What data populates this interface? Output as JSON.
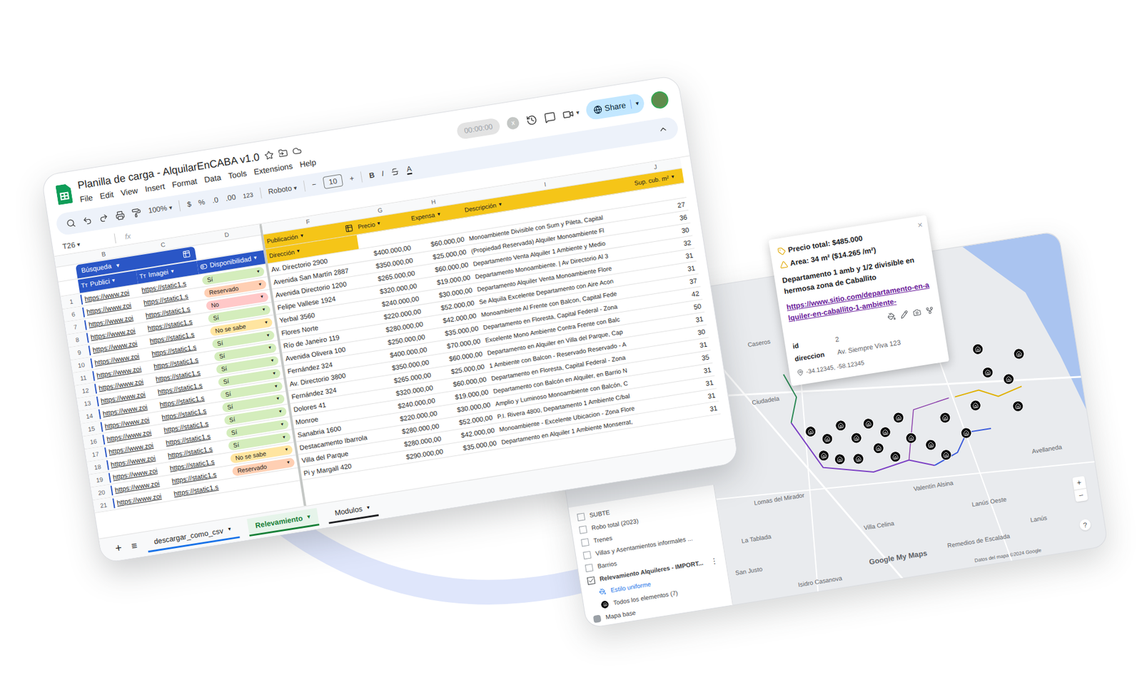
{
  "sheet": {
    "title": "Planilla de carga - AlquilarEnCABA v1.0",
    "menus": [
      "File",
      "Edit",
      "View",
      "Insert",
      "Format",
      "Data",
      "Tools",
      "Extensions",
      "Help"
    ],
    "timer": "00:00:00",
    "timer_close": "x",
    "share": "Share",
    "caret": "▾",
    "toolbar": {
      "zoom": "100%",
      "currency": "$",
      "percent": "%",
      "dec_less": ".0",
      "dec_more": ".00",
      "number_format": "123",
      "font": "Roboto",
      "size_minus": "−",
      "font_size": "10",
      "size_plus": "+",
      "bold": "B",
      "italic": "I",
      "text_color": "A"
    },
    "cell_ref": "T26",
    "fx": "fx",
    "left_columns": [
      "B",
      "C",
      "D"
    ],
    "right_columns": [
      "F",
      "G",
      "H",
      "I",
      "J"
    ],
    "left_group": "Búsqueda",
    "left_headers": [
      {
        "icon": "Tт",
        "label": "Publici"
      },
      {
        "icon": "Tт",
        "label": "Imagei"
      },
      {
        "icon": "",
        "label": "Disponibilidad"
      }
    ],
    "right_headers": [
      "Publicación",
      "Precio",
      "Expensa",
      "Descripción",
      "Sup. cub. m²"
    ],
    "right_subheader": "Dirección",
    "rows": [
      {
        "n": "1",
        "link": "https://www.zoi",
        "image": "https://static1.s",
        "availability": "Sí",
        "availability_color": "#d4edbc",
        "address": "Av. Directorio 2900",
        "price": "$400.000,00",
        "expense": "$60.000,00",
        "description": "Monoambiente Divisible con Sum y Pileta, Capital",
        "area": "27"
      },
      {
        "n": "6",
        "link": "https://www.zoi",
        "image": "https://static1.s",
        "availability": "Reservado",
        "availability_color": "#ffcfb3",
        "address": "Avenida San Martín 2887",
        "price": "$350.000,00",
        "expense": "$25.000,00",
        "description": "(Propiedad Reservada) Alquiler Monoambiente Fl",
        "area": "36"
      },
      {
        "n": "7",
        "link": "https://www.zoi",
        "image": "https://static1.s",
        "availability": "No",
        "availability_color": "#ffc8c8",
        "address": "Avenida Directorio 1200",
        "price": "$265.000,00",
        "expense": "$60.000,00",
        "description": "Departamento Venta Alquiler 1 Ambiente y Medio",
        "area": "30"
      },
      {
        "n": "8",
        "link": "https://www.zoi",
        "image": "https://static1.s",
        "availability": "Sí",
        "availability_color": "#d4edbc",
        "address": "Felipe Vallese 1924",
        "price": "$320.000,00",
        "expense": "$19.000,00",
        "description": "Departamento Monoambiente. | Av Directorio Al 3",
        "area": "32"
      },
      {
        "n": "9",
        "link": "https://www.zoi",
        "image": "https://static1.s",
        "availability": "No se sabe",
        "availability_color": "#ffe5a0",
        "address": "Yerbal 3560",
        "price": "$240.000,00",
        "expense": "$30.000,00",
        "description": "Departamento Alquiler Venta Monoambiente Flore",
        "area": "31"
      },
      {
        "n": "10",
        "link": "https://www.zoi",
        "image": "https://static1.s",
        "availability": "Sí",
        "availability_color": "#d4edbc",
        "address": "Flores Norte",
        "price": "$220.000,00",
        "expense": "$52.000,00",
        "description": "Se Alquila Excelente Departamento con Aire Acon",
        "area": "31"
      },
      {
        "n": "11",
        "link": "https://www.zoi",
        "image": "https://static1.s",
        "availability": "Sí",
        "availability_color": "#d4edbc",
        "address": "Río de Janeiro 119",
        "price": "$280.000,00",
        "expense": "$42.000,00",
        "description": "Monoambiente Al Frente con Balcon, Capital Fede",
        "area": "37"
      },
      {
        "n": "12",
        "link": "https://www.zoi",
        "image": "https://static1.s",
        "availability": "Sí",
        "availability_color": "#d4edbc",
        "address": "Avenida Olivera 100",
        "price": "$250.000,00",
        "expense": "$35.000,00",
        "description": "Departamento en Floresta, Capital Federal - Zona",
        "area": "42"
      },
      {
        "n": "13",
        "link": "https://www.zoi",
        "image": "https://static1.s",
        "availability": "Sí",
        "availability_color": "#d4edbc",
        "address": "Fernández 324",
        "price": "$400.000,00",
        "expense": "$70.000,00",
        "description": "Excelente Mono Ambiente Contra Frente con Balc",
        "area": "50"
      },
      {
        "n": "14",
        "link": "https://www.zoi",
        "image": "https://static1.s",
        "availability": "Sí",
        "availability_color": "#d4edbc",
        "address": "Av. Directorio 3800",
        "price": "$350.000,00",
        "expense": "$60.000,00",
        "description": "Departamento en Alquiler en Villa del Parque, Cap",
        "area": "31"
      },
      {
        "n": "15",
        "link": "https://www.zoi",
        "image": "https://static1.s",
        "availability": "Sí",
        "availability_color": "#d4edbc",
        "address": "Fernández 324",
        "price": "$265.000,00",
        "expense": "$25.000,00",
        "description": "1 Ambiente con Balcon - Reservado Reservado - A",
        "area": "30"
      },
      {
        "n": "16",
        "link": "https://www.zoi",
        "image": "https://static1.s",
        "availability": "Sí",
        "availability_color": "#d4edbc",
        "address": "Dolores 41",
        "price": "$320.000,00",
        "expense": "$60.000,00",
        "description": "Departamento en Floresta, Capital Federal - Zona",
        "area": "31"
      },
      {
        "n": "17",
        "link": "https://www.zoi",
        "image": "https://static1.s",
        "availability": "Sí",
        "availability_color": "#d4edbc",
        "address": "Monroe",
        "price": "$240.000,00",
        "expense": "$19.000,00",
        "description": "Departamento con Balcón en Alquiler, en Barrio N",
        "area": "35"
      },
      {
        "n": "18",
        "link": "https://www.zoi",
        "image": "https://static1.s",
        "availability": "Sí",
        "availability_color": "#d4edbc",
        "address": "Sanabria 1600",
        "price": "$220.000,00",
        "expense": "$30.000,00",
        "description": "Amplio y Luminoso Monoambiente con Balcón, C",
        "area": "31"
      },
      {
        "n": "19",
        "link": "https://www.zoi",
        "image": "https://static1.s",
        "availability": "No se sabe",
        "availability_color": "#ffe5a0",
        "address": "Destacamento Ibarrola",
        "price": "$280.000,00",
        "expense": "$52.000,00",
        "description": "P.I. Rivera 4800, Departamento 1 Ambiente C/bal",
        "area": "31"
      },
      {
        "n": "20",
        "link": "https://www.zoi",
        "image": "https://static1.s",
        "availability": "Reservado",
        "availability_color": "#ffcfb3",
        "address": "Villa del Parque",
        "price": "$280.000,00",
        "expense": "$42.000,00",
        "description": "Monoambiente - Excelente Ubicacion - Zona Flore",
        "area": "31"
      },
      {
        "n": "21",
        "link": "https://www.zoi",
        "image": "https://static1.s",
        "availability": "",
        "availability_color": "#ffffff",
        "address": "Pi y Margall 420",
        "price": "$290.000,00",
        "expense": "$35.000,00",
        "description": "Departamento en Alquiler 1 Ambiente Monserrat,",
        "area": "31"
      }
    ],
    "tabs": [
      {
        "label": "descargar_como_csv",
        "selected": false,
        "color": "#1a73e8"
      },
      {
        "label": "Relevamiento",
        "selected": true,
        "color": "#188038"
      },
      {
        "label": "Modulos",
        "selected": false,
        "color": "#202124"
      }
    ],
    "add_sheet": "+",
    "all_sheets": "≡"
  },
  "map": {
    "popup": {
      "close": "×",
      "price": "Precio total: $485.000",
      "area": "Area: 34 m² ($14.265 /m²)",
      "title": "Departamento 1 amb y 1/2 divisible en hermosa zona de Caballito",
      "link": "https://www.sitio.com/departamento-en-alquiler-en-caballito-1-ambiente-",
      "fields": [
        {
          "key": "id",
          "value": "2"
        },
        {
          "key": "direccion",
          "value": "Av. Siempre Viva 123"
        }
      ],
      "coords": "-34.12345, -58.12345"
    },
    "layers": [
      {
        "label": "SUBTE",
        "kind": "checkbox",
        "checked": false
      },
      {
        "label": "Robo total (2023)",
        "kind": "checkbox",
        "checked": false
      },
      {
        "label": "Trenes",
        "kind": "checkbox",
        "checked": false
      },
      {
        "label": "Villas y Asentamientos informales ...",
        "kind": "checkbox",
        "checked": false
      },
      {
        "label": "Barrios",
        "kind": "checkbox",
        "checked": false
      },
      {
        "label": "Relevamiento Alquileres - IMPORT...",
        "kind": "checkbox",
        "checked": true,
        "menu": "⋮"
      },
      {
        "label": "Estilo uniforme",
        "kind": "style",
        "checked": false
      },
      {
        "label": "Todos los elementos (7)",
        "kind": "group",
        "checked": false
      },
      {
        "label": "Mapa base",
        "kind": "base",
        "checked": false
      }
    ],
    "labels": [
      "Caseros",
      "Ciudadela",
      "Lomas del Mirador",
      "La Tablada",
      "San Justo",
      "Isidro Casanova",
      "Villa Celina",
      "Valentín Alsina",
      "Lanús Oeste",
      "Lanús",
      "Avellaneda",
      "Remedios de Escalada"
    ],
    "zoom_in": "+",
    "zoom_out": "−",
    "help": "?",
    "brand": "Google My Maps",
    "attribution": "Datos del mapa ©2024 Google"
  }
}
